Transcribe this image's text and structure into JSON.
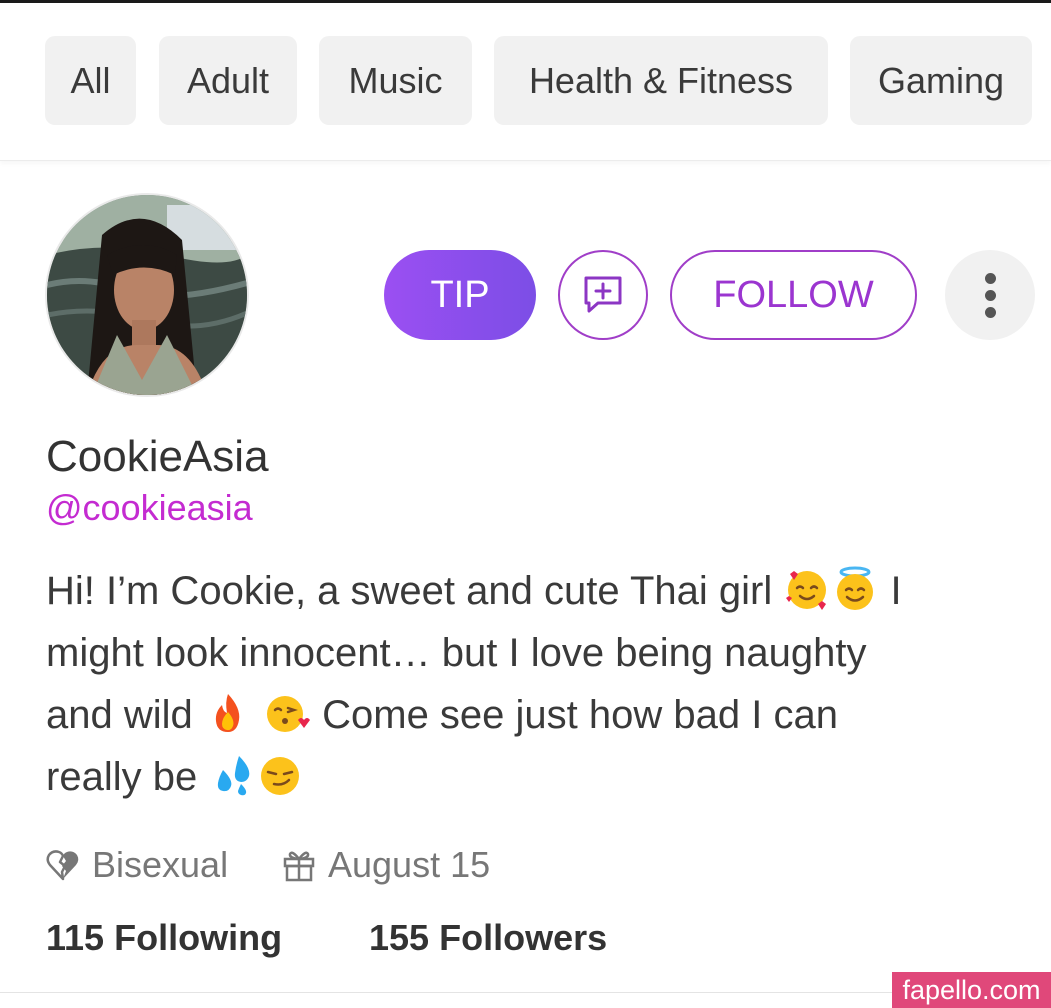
{
  "categories": [
    {
      "label": "All"
    },
    {
      "label": "Adult"
    },
    {
      "label": "Music"
    },
    {
      "label": "Health & Fitness"
    },
    {
      "label": "Gaming"
    }
  ],
  "profile": {
    "display_name": "CookieAsia",
    "handle": "@cookieasia",
    "bio": {
      "line1_text": "Hi! I’m Cookie, a sweet and cute Thai girl ",
      "line1_tail": " I",
      "line2": "might look innocent… but I love being naughty",
      "line3_head": "and wild ",
      "line3_tail": " Come see just how bad I can",
      "line4_head": "really be "
    },
    "orientation": "Bisexual",
    "birthday": "August 15",
    "following_count": "115",
    "following_label": "Following",
    "followers_count": "155",
    "followers_label": "Followers"
  },
  "actions": {
    "tip_label": "TIP",
    "follow_label": "FOLLOW"
  },
  "icons": {
    "message": "add-message-icon",
    "more": "more-vertical-icon",
    "orientation": "broken-heart-icon",
    "birthday": "gift-icon",
    "emojis": [
      "smiling-face-with-hearts-emoji",
      "smiling-face-with-halo-emoji",
      "fire-emoji",
      "face-blowing-kiss-emoji",
      "sweat-droplets-emoji",
      "smirking-face-emoji"
    ]
  },
  "colors": {
    "accent": "#a03ec8",
    "handle": "#c42bd1",
    "tip_gradient_start": "#9b4ff2",
    "tip_gradient_end": "#7c4ee6",
    "watermark_bg": "#e0487a"
  },
  "watermark": "fapello.com"
}
